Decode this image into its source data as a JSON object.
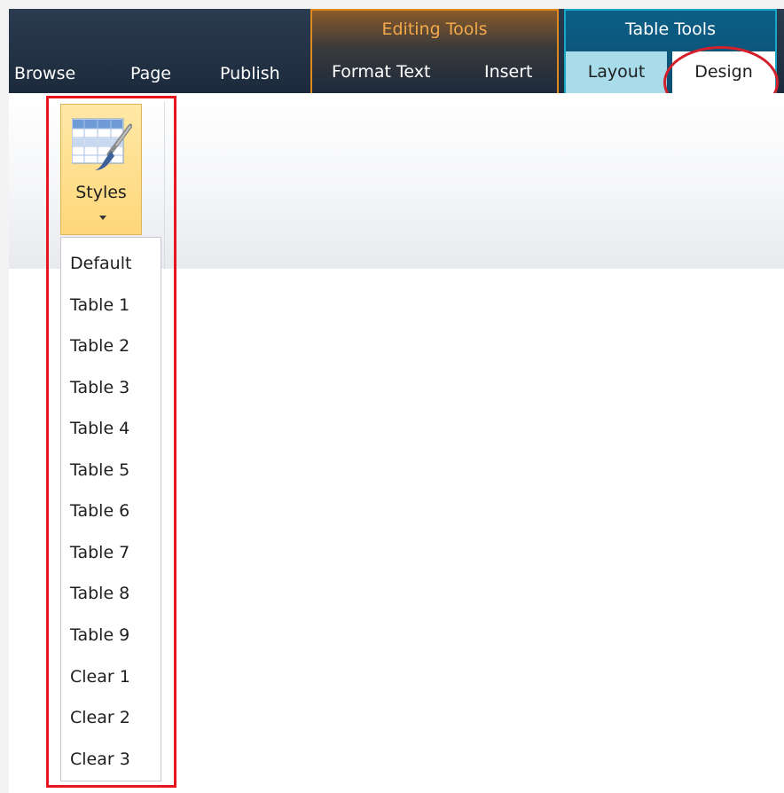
{
  "ribbon": {
    "tabs": {
      "browse": "Browse",
      "page": "Page",
      "publish": "Publish",
      "format_text": "Format Text",
      "insert": "Insert",
      "layout": "Layout",
      "design": "Design"
    },
    "groups": {
      "editing_tools": "Editing Tools",
      "table_tools": "Table Tools"
    },
    "colors": {
      "editing_accent": "#e08a1e",
      "table_accent": "#17a8c8",
      "annotation_red": "#e8141e"
    }
  },
  "styles_button": {
    "label": "Styles",
    "icon": "table-paintbrush-icon"
  },
  "styles_menu": {
    "items": [
      "Default",
      "Table 1",
      "Table 2",
      "Table 3",
      "Table 4",
      "Table 5",
      "Table 6",
      "Table 7",
      "Table 8",
      "Table 9",
      "Clear 1",
      "Clear 2",
      "Clear 3"
    ]
  }
}
